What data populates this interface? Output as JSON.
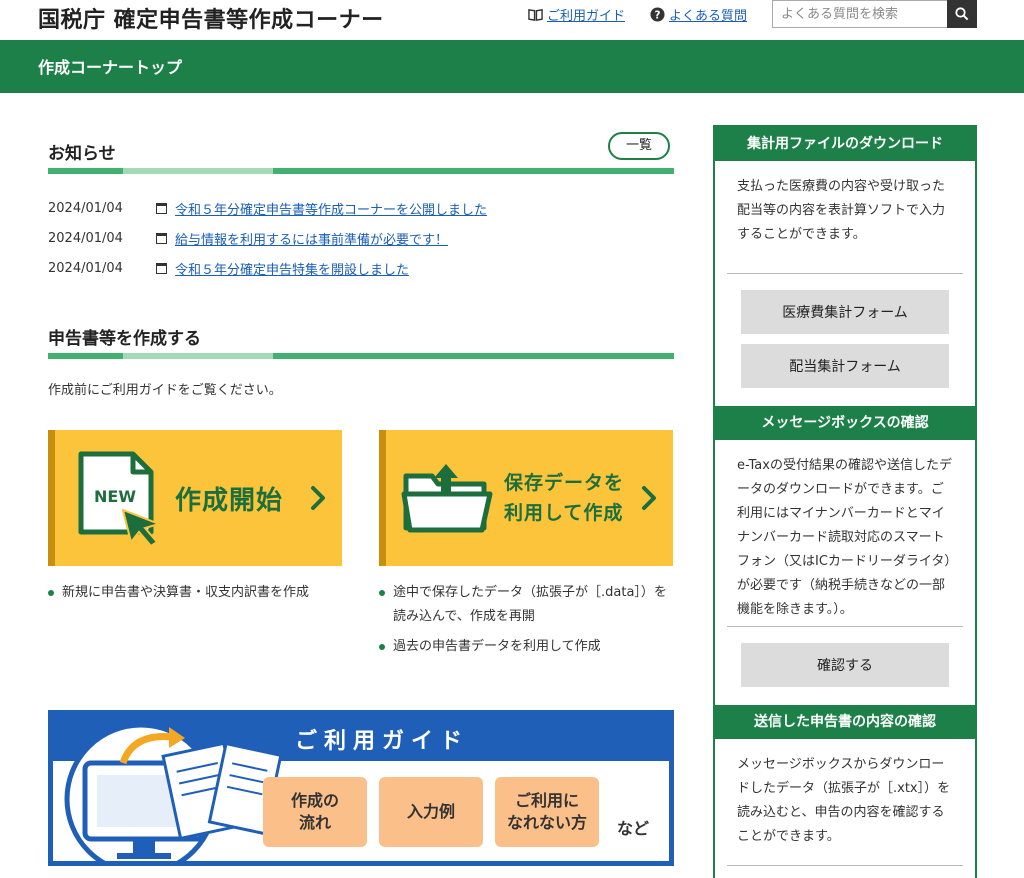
{
  "header": {
    "site_title": "国税庁 確定申告書等作成コーナー",
    "guide_link": "ご利用ガイド",
    "faq_link": "よくある質問",
    "search_placeholder": "よくある質問を検索"
  },
  "nav": {
    "title": "作成コーナートップ"
  },
  "news": {
    "title": "お知らせ",
    "list_button": "一覧",
    "items": [
      {
        "date": "2024/01/04",
        "text": "令和５年分確定申告書等作成コーナーを公開しました"
      },
      {
        "date": "2024/01/04",
        "text": "給与情報を利用するには事前準備が必要です！"
      },
      {
        "date": "2024/01/04",
        "text": "令和５年分確定申告特集を開設しました"
      }
    ]
  },
  "create": {
    "title": "申告書等を作成する",
    "intro": "作成前にご利用ガイドをご覧ください。",
    "new_card": {
      "badge": "NEW",
      "label": "作成開始"
    },
    "saved_card": {
      "label_line1": "保存データを",
      "label_line2": "利用して作成"
    },
    "new_bullets": [
      "新規に申告書や決算書・収支内訳書を作成"
    ],
    "saved_bullets": [
      "途中で保存したデータ（拡張子が［.data］）を読み込んで、作成を再開",
      "過去の申告書データを利用して作成"
    ]
  },
  "guide_banner": {
    "title": "ご利用ガイド",
    "chip1_line1": "作成の",
    "chip1_line2": "流れ",
    "chip2": "入力例",
    "chip3_line1": "ご利用に",
    "chip3_line2": "なれない方",
    "etc": "など"
  },
  "sidebar": {
    "download": {
      "title": "集計用ファイルのダウンロード",
      "text": "支払った医療費の内容や受け取った配当等の内容を表計算ソフトで入力することができます。",
      "button1": "医療費集計フォーム",
      "button2": "配当集計フォーム"
    },
    "messagebox": {
      "title": "メッセージボックスの確認",
      "text": "e-Taxの受付結果の確認や送信したデータのダウンロードができます。ご利用にはマイナンバーカードとマイナンバーカード読取対応のスマートフォン（又はICカードリーダライタ）が必要です（納税手続きなどの一部機能を除きます。）。",
      "button": "確認する"
    },
    "sent": {
      "title": "送信した申告書の内容の確認",
      "text": "メッセージボックスからダウンロードしたデータ（拡張子が［.xtx］）を読み込むと、申告の内容を確認することができます。"
    }
  },
  "colors": {
    "brand_green": "#1c8048",
    "card_yellow": "#fcc43a",
    "guide_blue": "#1f5fb8",
    "link_blue": "#1a5eb8"
  }
}
